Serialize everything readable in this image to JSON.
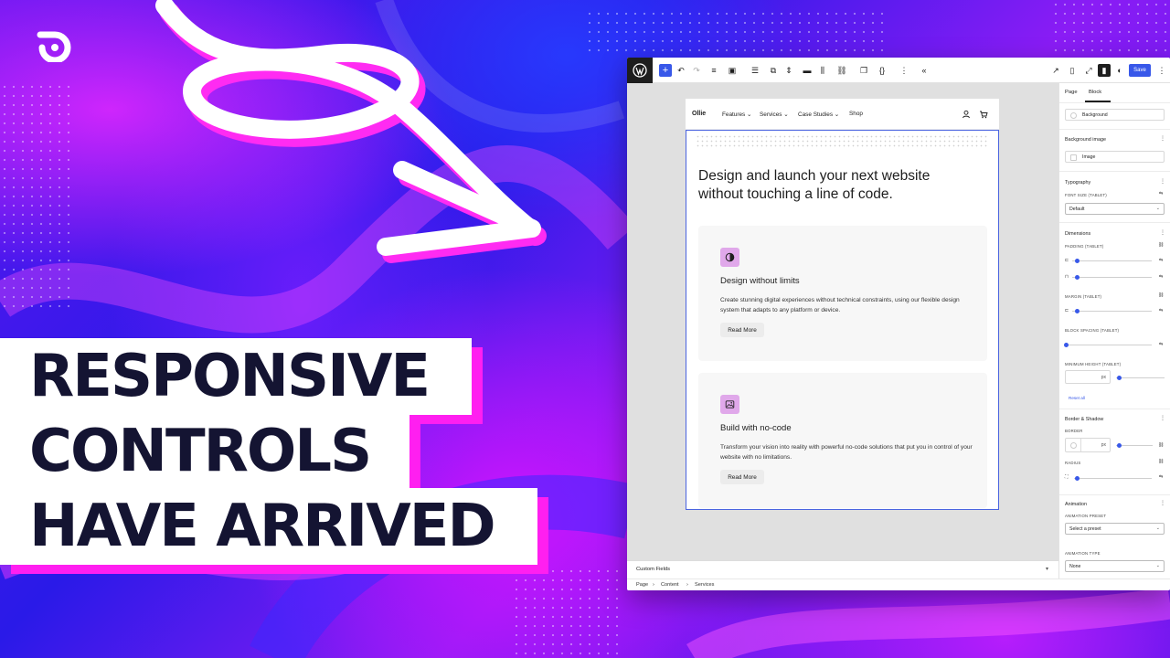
{
  "headline": {
    "line1": "RESPONSIVE",
    "line2": "CONTROLS",
    "line3": "HAVE ARRIVED"
  },
  "colors": {
    "headline_text": "#141432",
    "accent_pink": "#ff1ff0",
    "wp_blue": "#3858e9",
    "card_icon_bg": "#e0a8ea"
  },
  "toolbar": {
    "save_label": "Save"
  },
  "site": {
    "logo": "Ollie",
    "nav": [
      "Features",
      "Services",
      "Case Studies",
      "Shop"
    ],
    "hero_title": "Design and launch your next website without touching a line of code.",
    "cards": [
      {
        "icon": "contrast-icon",
        "title": "Design without limits",
        "description": "Create stunning digital experiences without technical constraints, using our flexible design system that adapts to any platform or device.",
        "button": "Read More"
      },
      {
        "icon": "image-icon",
        "title": "Build with no-code",
        "description": "Transform your vision into reality with powerful no-code solutions that put you in control of your website with no limitations.",
        "button": "Read More"
      }
    ]
  },
  "sidebar": {
    "tabs": [
      "Page",
      "Block"
    ],
    "background_label": "Background",
    "background_image_heading": "Background image",
    "image_label": "Image",
    "typography_heading": "Typography",
    "font_size_label": "FONT SIZE (TABLET)",
    "font_size_value": "Default",
    "dimensions_heading": "Dimensions",
    "padding_label": "PADDING (TABLET)",
    "margin_label": "MARGIN (TABLET)",
    "block_spacing_label": "BLOCK SPACING (TABLET)",
    "min_height_label": "MINIMUM HEIGHT (TABLET)",
    "min_height_unit": "px",
    "reset_all": "Reset all",
    "border_shadow_heading": "Border & Shadow",
    "border_label": "BORDER",
    "border_unit": "px",
    "radius_label": "RADIUS",
    "animation_heading": "Animation",
    "animation_preset_label": "ANIMATION PRESET",
    "animation_preset_value": "Select a preset",
    "animation_type_label": "ANIMATION TYPE",
    "animation_type_value": "None"
  },
  "footer": {
    "custom_fields": "Custom Fields",
    "breadcrumb": [
      "Page",
      "Content",
      "Services"
    ]
  }
}
